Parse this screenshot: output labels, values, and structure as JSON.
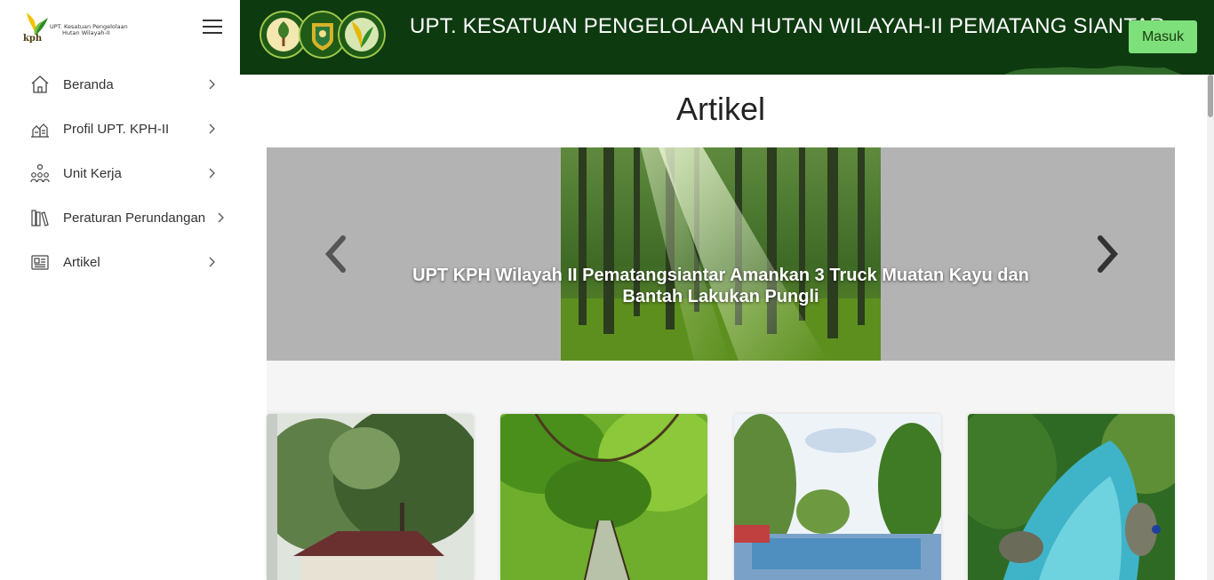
{
  "brand": {
    "line1": "UPT. Kesatuan Pengelolaan",
    "line2": "Hutan Wilayah-II",
    "short": "kph"
  },
  "sidebar": {
    "items": [
      {
        "label": "Beranda",
        "icon": "home-icon"
      },
      {
        "label": "Profil UPT. KPH-II",
        "icon": "buildings-icon"
      },
      {
        "label": "Unit Kerja",
        "icon": "people-network-icon"
      },
      {
        "label": "Peraturan Perundangan",
        "icon": "books-icon"
      },
      {
        "label": "Artikel",
        "icon": "newspaper-icon"
      }
    ]
  },
  "header": {
    "title": "UPT. KESATUAN PENGELOLAAN HUTAN WILAYAH-II PEMATANG SIANTAR",
    "login_label": "Masuk",
    "background": "#0e3a10",
    "login_color": "#7ee07a"
  },
  "main": {
    "title": "Artikel",
    "carousel": {
      "caption": "UPT KPH Wilayah II Pematangsiantar Amankan 3 Truck Muatan Kayu dan Bantah Lakukan Pungli"
    },
    "cards": [
      {
        "image": "tree-building-photo"
      },
      {
        "image": "forest-bridge-photo"
      },
      {
        "image": "park-entrance-photo"
      },
      {
        "image": "blue-river-photo"
      }
    ]
  }
}
